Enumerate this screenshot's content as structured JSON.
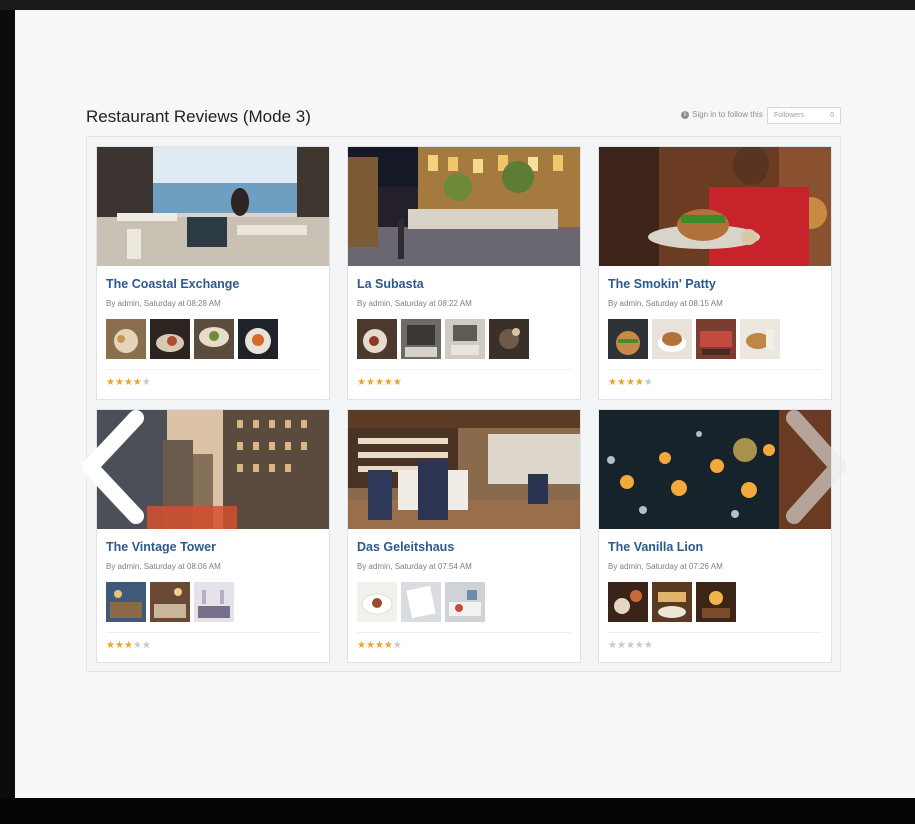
{
  "page": {
    "title": "Restaurant Reviews (Mode 3)"
  },
  "follow": {
    "signin_text": "Sign in to follow this",
    "select_value": "Followers",
    "select_count": "0"
  },
  "cards": [
    {
      "name": "The Coastal Exchange",
      "meta": "By admin, Saturday at 08:28 AM",
      "rating": 4,
      "stars": "★★★★★"
    },
    {
      "name": "La Subasta",
      "meta": "By admin, Saturday at 08:22 AM",
      "rating": 5,
      "stars": "★★★★★"
    },
    {
      "name": "The Smokin' Patty",
      "meta": "By admin, Saturday at 08:15 AM",
      "rating": 4,
      "stars": "★★★★★"
    },
    {
      "name": "The Vintage Tower",
      "meta": "By admin, Saturday at 08:06 AM",
      "rating": 3,
      "stars": "★★★★★"
    },
    {
      "name": "Das Geleitshaus",
      "meta": "By admin, Saturday at 07:54 AM",
      "rating": 4,
      "stars": "★★★★★"
    },
    {
      "name": "The Vanilla Lion",
      "meta": "By admin, Saturday at 07:26 AM",
      "rating": 0,
      "stars": "★★★★★"
    }
  ],
  "icons": {
    "prev": "chevron-left-icon",
    "next": "chevron-right-icon",
    "info": "info-icon",
    "select": "dropdown-icon",
    "star": "star-icon"
  },
  "colors": {
    "title_link": "#2c5a8c",
    "star_on": "#f0a32a",
    "star_off": "#c5c8cc"
  }
}
